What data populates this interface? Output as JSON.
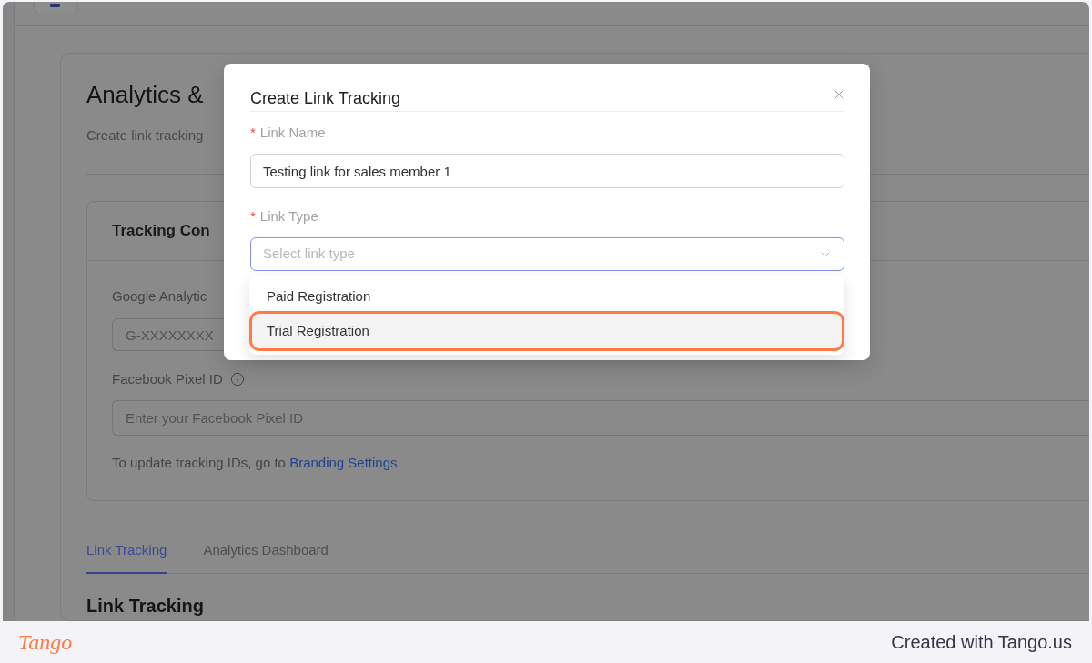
{
  "page": {
    "title": "Analytics &",
    "subtitle": "Create link tracking",
    "tracking_card": {
      "title": "Tracking Con",
      "fields": [
        {
          "label": "Google Analytic",
          "placeholder": "G-XXXXXXXX"
        },
        {
          "label": "Facebook Pixel ID",
          "placeholder": "Enter your Facebook Pixel ID",
          "info_icon": true
        }
      ],
      "note": {
        "text": "To update tracking IDs, go to",
        "link": "Branding Settings"
      }
    },
    "tabs": [
      {
        "label": "Link Tracking",
        "selected": true
      },
      {
        "label": "Analytics Dashboard",
        "selected": false
      }
    ],
    "section_title": "Link Tracking"
  },
  "modal": {
    "title": "Create Link Tracking",
    "fields": [
      {
        "kind": "text",
        "required_mark": "*",
        "label": "Link Name",
        "value": "Testing link for sales member 1"
      },
      {
        "kind": "select",
        "required_mark": "*",
        "label": "Link Type",
        "placeholder": "Select link type",
        "focused": true,
        "open": true,
        "options": [
          {
            "label": "Paid Registration",
            "highlighted": false
          },
          {
            "label": "Trial Registration",
            "highlighted": true
          }
        ]
      }
    ]
  },
  "footer": {
    "logo": "Tango",
    "credit": "Created with Tango.us"
  }
}
